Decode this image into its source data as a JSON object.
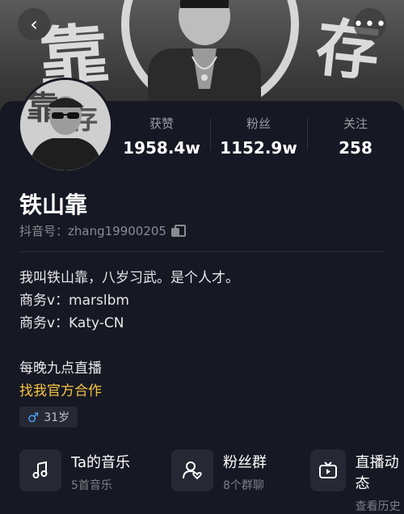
{
  "cover": {
    "brush_left": "靠",
    "brush_right": "存"
  },
  "nav": {
    "back_icon": "‹",
    "more_icon": "•••"
  },
  "stats": [
    {
      "label": "获赞",
      "value": "1958.4w"
    },
    {
      "label": "粉丝",
      "value": "1152.9w"
    },
    {
      "label": "关注",
      "value": "258"
    }
  ],
  "profile": {
    "name": "铁山靠",
    "uid": "抖音号：zhang19900205"
  },
  "bio": {
    "line1": "我叫铁山靠，八岁习武。是个人才。",
    "line2": "商务v：marslbm",
    "line3": "商务v：Katy-CN",
    "line4": "每晚九点直播",
    "line5": "找我官方合作"
  },
  "tags": {
    "gender_icon": "♂",
    "age": "31岁"
  },
  "cards": [
    {
      "title": "Ta的音乐",
      "sub": "5首音乐",
      "icon": "music-note-icon"
    },
    {
      "title": "粉丝群",
      "sub": "8个群聊",
      "icon": "fan-group-icon"
    },
    {
      "title": "直播动态",
      "sub": "查看历史",
      "icon": "live-tv-icon"
    }
  ],
  "colors": {
    "background": "#161823",
    "accent_gold": "#f7c544",
    "male_blue": "#4ea6ff"
  }
}
